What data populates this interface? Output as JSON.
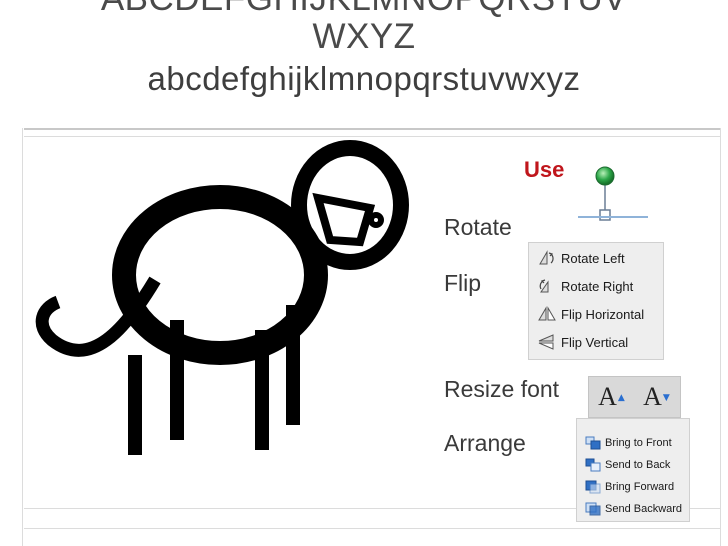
{
  "title": {
    "line1": "ABCDEFGHIJKLMNOPQRSTUV",
    "line2": "WXYZ",
    "line3": "abcdefghijklmnopqrstuvwxyz"
  },
  "use_label": "Use",
  "labels": {
    "rotate": "Rotate",
    "flip": "Flip",
    "resize_font": "Resize font",
    "arrange": "Arrange"
  },
  "rotate_menu": [
    {
      "label": "Rotate Left",
      "icon": "rotate-left-icon"
    },
    {
      "label": "Rotate Right",
      "icon": "rotate-right-icon"
    },
    {
      "label": "Flip Horizontal",
      "icon": "flip-horizontal-icon"
    },
    {
      "label": "Flip Vertical",
      "icon": "flip-vertical-icon"
    }
  ],
  "font_buttons": [
    {
      "glyph": "A",
      "arrow": "▲",
      "name": "grow-font-button"
    },
    {
      "glyph": "A",
      "arrow": "▼",
      "name": "shrink-font-button"
    }
  ],
  "arrange_menu": [
    {
      "label": "Bring to Front",
      "icon": "bring-to-front-icon"
    },
    {
      "label": "Send to Back",
      "icon": "send-to-back-icon"
    },
    {
      "label": "Bring Forward",
      "icon": "bring-forward-icon"
    },
    {
      "label": "Send Backward",
      "icon": "send-backward-icon"
    }
  ],
  "colors": {
    "accent_red": "#c0161c",
    "handle_green": "#2ea84a",
    "panel_bg": "#eeeeee"
  }
}
